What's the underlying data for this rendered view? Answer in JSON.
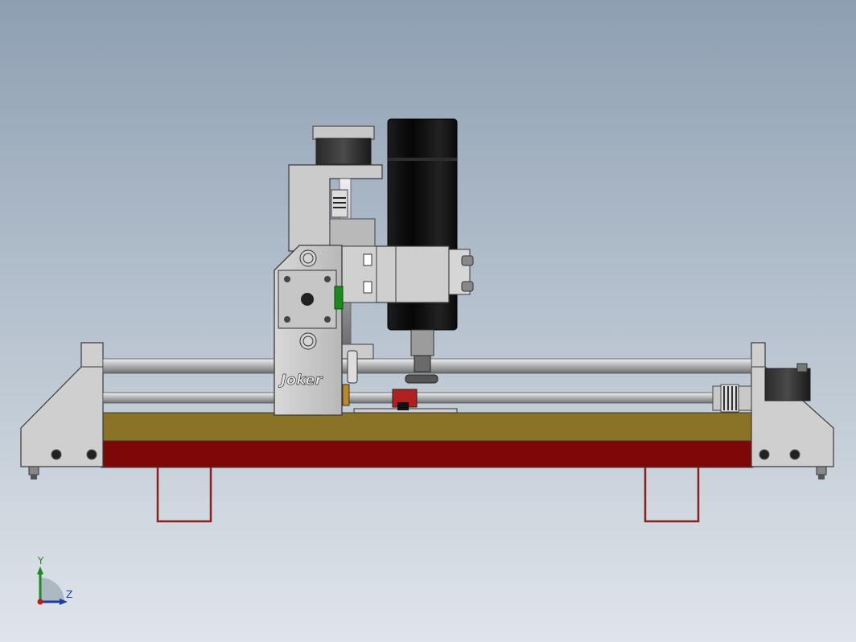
{
  "viewport": {
    "background_top": "#8e9fb2",
    "background_bottom": "#dfe5ea"
  },
  "model": {
    "engraving": "Joker",
    "colors": {
      "frame": "#c9c9c9",
      "frame_edge": "#3a3a3a",
      "spindle": "#0d0d0d",
      "table_top": "#8a7327",
      "table_bottom": "#7c0808",
      "legs": "#8b2020",
      "rods": "#b4b6b8"
    }
  },
  "triad": {
    "y_label": "Y",
    "z_label": "Z",
    "y_color": "#1d8a1d",
    "z_color": "#1d3aa6",
    "origin_color": "#c01818"
  }
}
